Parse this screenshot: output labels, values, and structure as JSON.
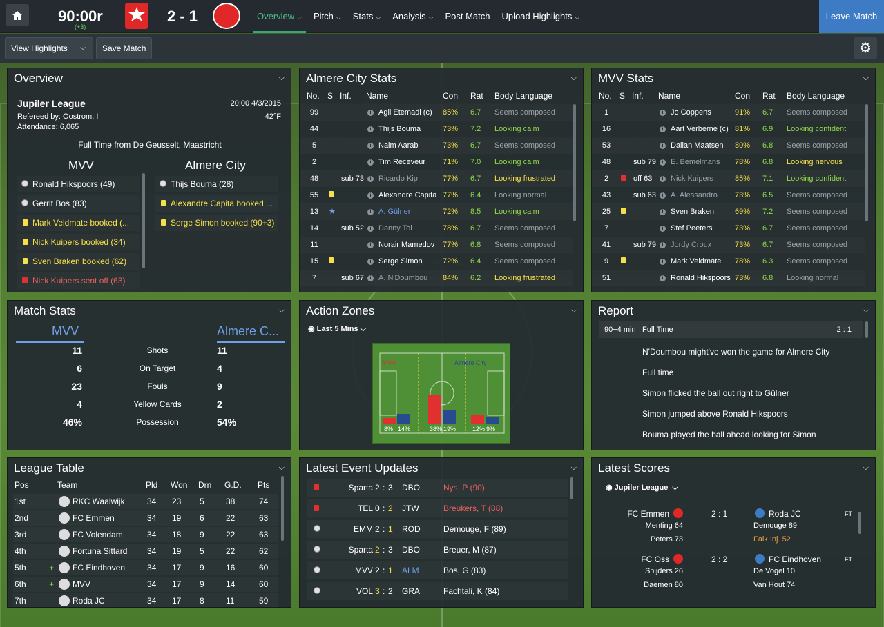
{
  "topbar": {
    "clock": "90:00r",
    "added": "(+3)",
    "score": "2 - 1",
    "nav": [
      "Overview",
      "Pitch",
      "Stats",
      "Analysis",
      "Post Match",
      "Upload Highlights"
    ],
    "leave": "Leave Match"
  },
  "subbar": {
    "highlights": "View Highlights",
    "save": "Save Match"
  },
  "overview": {
    "title": "Overview",
    "league": "Jupiler League",
    "datetime": "20:00 4/3/2015",
    "referee": "Refereed by: Oostrom, I",
    "temp": "42°F",
    "attendance": "Attendance: 6,065",
    "fulltime": "Full Time from De Geusselt, Maastricht",
    "home": "MVV",
    "away": "Almere City",
    "home_events": [
      {
        "icon": "ball",
        "text": "Ronald Hikspoors (49)",
        "c": ""
      },
      {
        "icon": "ball",
        "text": "Gerrit Bos (83)",
        "c": ""
      },
      {
        "icon": "yellow",
        "text": "Mark Veldmate booked (...",
        "c": "y"
      },
      {
        "icon": "yellow",
        "text": "Nick Kuipers booked (34)",
        "c": "y"
      },
      {
        "icon": "yellow",
        "text": "Sven Braken booked (62)",
        "c": "y"
      },
      {
        "icon": "red",
        "text": "Nick Kuipers sent off (63)",
        "c": "r"
      }
    ],
    "away_events": [
      {
        "icon": "ball",
        "text": "Thijs Bouma (28)",
        "c": ""
      },
      {
        "icon": "yellow",
        "text": "Alexandre Capita booked ...",
        "c": "y"
      },
      {
        "icon": "yellow",
        "text": "Serge Simon booked (90+3)",
        "c": "y"
      }
    ]
  },
  "almere": {
    "title": "Almere City Stats",
    "headers": [
      "No.",
      "S",
      "Inf.",
      "Name",
      "Con",
      "Rat",
      "Body Language"
    ],
    "rows": [
      [
        "99",
        "",
        "",
        "Agil Etemadi (c)",
        "85%",
        "6.7",
        "Seems composed",
        "w",
        "gr"
      ],
      [
        "44",
        "",
        "",
        "Thijs Bouma",
        "73%",
        "7.2",
        "Looking calm",
        "w",
        "g"
      ],
      [
        "5",
        "",
        "",
        "Naim Aarab",
        "73%",
        "6.7",
        "Seems composed",
        "w",
        "gr"
      ],
      [
        "2",
        "",
        "",
        "Tim Receveur",
        "71%",
        "7.0",
        "Looking calm",
        "w",
        "g"
      ],
      [
        "48",
        "",
        "sub 73",
        "Ricardo Kip",
        "77%",
        "6.7",
        "Looking frustrated",
        "gr",
        "y"
      ],
      [
        "55",
        "yellow",
        "",
        "Alexandre Capita",
        "77%",
        "6.4",
        "Looking normal",
        "w",
        "gr"
      ],
      [
        "13",
        "star",
        "",
        "A. Gülner",
        "72%",
        "8.5",
        "Looking calm",
        "b",
        "g"
      ],
      [
        "14",
        "",
        "sub 52",
        "Danny Tol",
        "78%",
        "6.7",
        "Seems composed",
        "gr",
        "gr"
      ],
      [
        "11",
        "",
        "",
        "Norair Mamedov",
        "77%",
        "6.8",
        "Seems composed",
        "w",
        "gr"
      ],
      [
        "15",
        "yellow",
        "",
        "Serge Simon",
        "72%",
        "6.4",
        "Seems composed",
        "w",
        "gr"
      ],
      [
        "7",
        "",
        "sub 67",
        "A. N'Doumbou",
        "84%",
        "6.2",
        "Looking frustrated",
        "gr",
        "y"
      ]
    ]
  },
  "mvv": {
    "title": "MVV Stats",
    "headers": [
      "No.",
      "S",
      "Inf.",
      "Name",
      "Con",
      "Rat",
      "Body Language"
    ],
    "rows": [
      [
        "1",
        "",
        "",
        "Jo Coppens",
        "91%",
        "6.7",
        "Seems composed",
        "w",
        "gr"
      ],
      [
        "16",
        "",
        "",
        "Aart Verberne (c)",
        "81%",
        "6.9",
        "Looking confident",
        "w",
        "g"
      ],
      [
        "53",
        "",
        "",
        "Dalian Maatsen",
        "80%",
        "6.8",
        "Seems composed",
        "w",
        "gr"
      ],
      [
        "48",
        "",
        "sub 79",
        "E. Bemelmans",
        "78%",
        "6.8",
        "Looking nervous",
        "gr",
        "y"
      ],
      [
        "2",
        "red",
        "off 63",
        "Nick Kuipers",
        "85%",
        "7.1",
        "Looking confident",
        "gr",
        "g"
      ],
      [
        "43",
        "",
        "sub 63",
        "A. Alessandro",
        "73%",
        "6.5",
        "Seems composed",
        "gr",
        "gr"
      ],
      [
        "25",
        "yellow",
        "",
        "Sven Braken",
        "69%",
        "7.2",
        "Seems composed",
        "w",
        "gr"
      ],
      [
        "7",
        "",
        "",
        "Stef Peeters",
        "73%",
        "6.7",
        "Seems composed",
        "w",
        "gr"
      ],
      [
        "41",
        "",
        "sub 79",
        "Jordy Croux",
        "73%",
        "6.7",
        "Seems composed",
        "gr",
        "gr"
      ],
      [
        "9",
        "yellow",
        "",
        "Mark Veldmate",
        "78%",
        "6.3",
        "Seems composed",
        "w",
        "gr"
      ],
      [
        "51",
        "",
        "",
        "Ronald Hikspoors",
        "73%",
        "6.8",
        "Looking normal",
        "w",
        "gr"
      ]
    ]
  },
  "matchstats": {
    "title": "Match Stats",
    "home": "MVV",
    "away": "Almere C...",
    "rows": [
      [
        "11",
        "Shots",
        "11"
      ],
      [
        "6",
        "On Target",
        "4"
      ],
      [
        "23",
        "Fouls",
        "9"
      ],
      [
        "4",
        "Yellow Cards",
        "2"
      ],
      [
        "46%",
        "Possession",
        "54%"
      ]
    ]
  },
  "actionzones": {
    "title": "Action Zones",
    "filter": "Last 5 Mins",
    "home": "MVV",
    "away": "Almere City",
    "zones": [
      {
        "home": 8,
        "away": 14,
        "hl": "8%",
        "al": "14%"
      },
      {
        "home": 38,
        "away": 19,
        "hl": "38%",
        "al": "19%"
      },
      {
        "home": 12,
        "away": 9,
        "hl": "12%",
        "al": "9%"
      }
    ]
  },
  "report": {
    "title": "Report",
    "minute": "90+4 min",
    "label": "Full Time",
    "score": "2 : 1",
    "lines": [
      "N'Doumbou might've won the game for Almere City",
      "Full time",
      "Simon flicked the ball out right to Gülner",
      "Simon jumped above Ronald Hikspoors",
      "Bouma played the ball ahead looking for Simon"
    ]
  },
  "league": {
    "title": "League Table",
    "headers": [
      "Pos",
      "Team",
      "Pld",
      "Won",
      "Drn",
      "G.D.",
      "Pts"
    ],
    "rows": [
      [
        "1st",
        "",
        "RKC Waalwijk",
        "34",
        "23",
        "5",
        "38",
        "74"
      ],
      [
        "2nd",
        "",
        "FC Emmen",
        "34",
        "19",
        "6",
        "22",
        "63"
      ],
      [
        "3rd",
        "",
        "FC Volendam",
        "34",
        "18",
        "9",
        "22",
        "63"
      ],
      [
        "4th",
        "",
        "Fortuna Sittard",
        "34",
        "19",
        "5",
        "22",
        "62"
      ],
      [
        "5th",
        "+",
        "FC Eindhoven",
        "34",
        "17",
        "9",
        "16",
        "60"
      ],
      [
        "6th",
        "+",
        "MVV",
        "34",
        "17",
        "9",
        "14",
        "60"
      ],
      [
        "7th",
        "",
        "Roda JC",
        "34",
        "17",
        "8",
        "11",
        "59"
      ]
    ]
  },
  "events": {
    "title": "Latest Event Updates",
    "rows": [
      [
        "red",
        "Sparta",
        "2",
        "3",
        "DBO",
        "Nys, P (90)",
        "r",
        "",
        ""
      ],
      [
        "red",
        "TEL",
        "0",
        "2",
        "JTW",
        "Breukers, T (88)",
        "r",
        "",
        "y"
      ],
      [
        "ball",
        "EMM",
        "2",
        "1",
        "ROD",
        "Demouge, F (89)",
        "",
        "",
        "y"
      ],
      [
        "ball",
        "Sparta",
        "2",
        "3",
        "DBO",
        "Breuer, M (87)",
        "",
        "y",
        ""
      ],
      [
        "ball",
        "MVV",
        "2",
        "1",
        "ALM",
        "Bos, G (83)",
        "",
        "",
        "y"
      ],
      [
        "ball",
        "VOL",
        "3",
        "2",
        "GRA",
        "Fachtali, K (84)",
        "",
        "y",
        ""
      ]
    ]
  },
  "scores": {
    "title": "Latest Scores",
    "filter": "Jupiler League",
    "matches": [
      {
        "home": "FC Emmen",
        "away": "Roda JC",
        "score": "2 : 1",
        "status": "FT",
        "home_scorers": [
          "Menting 64",
          "Peters 73"
        ],
        "away_scorers": [
          "Demouge 89",
          "Faik Inj. 52"
        ]
      },
      {
        "home": "FC Oss",
        "away": "FC Eindhoven",
        "score": "2 : 2",
        "status": "FT",
        "home_scorers": [
          "Snijders 26",
          "Daemen 80"
        ],
        "away_scorers": [
          "De Vogel 10",
          "Van Hout 74"
        ]
      }
    ]
  }
}
